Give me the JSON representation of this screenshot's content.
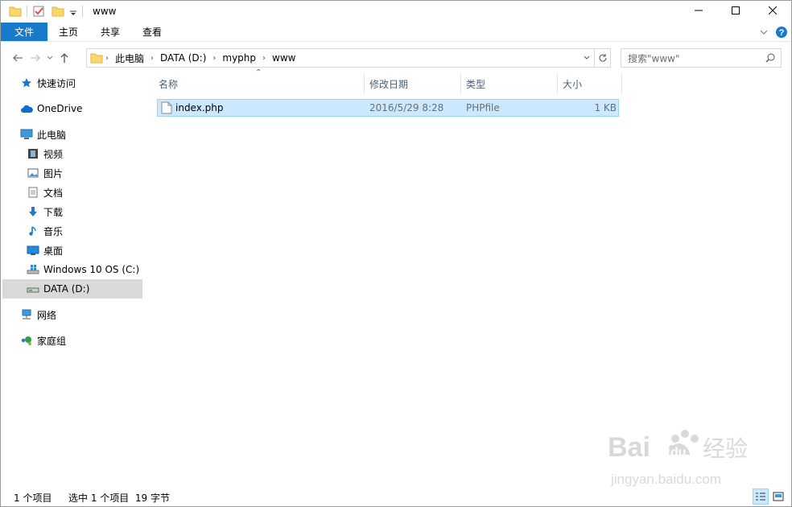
{
  "window": {
    "title": "www"
  },
  "ribbon": {
    "tabs": [
      "文件",
      "主页",
      "共享",
      "查看"
    ]
  },
  "address": {
    "crumbs": [
      "此电脑",
      "DATA (D:)",
      "myphp",
      "www"
    ]
  },
  "search": {
    "placeholder": "搜索\"www\""
  },
  "sidebar": {
    "items": [
      {
        "label": "快速访问",
        "icon": "star-icon"
      },
      {
        "label": "OneDrive",
        "icon": "onedrive-cloud-icon"
      },
      {
        "label": "此电脑",
        "icon": "computer-icon"
      },
      {
        "label": "视频",
        "icon": "video-icon"
      },
      {
        "label": "图片",
        "icon": "picture-icon"
      },
      {
        "label": "文档",
        "icon": "document-icon"
      },
      {
        "label": "下载",
        "icon": "download-icon"
      },
      {
        "label": "音乐",
        "icon": "music-icon"
      },
      {
        "label": "桌面",
        "icon": "desktop-icon"
      },
      {
        "label": "Windows 10 OS (C:)",
        "icon": "windows-drive-icon"
      },
      {
        "label": "DATA (D:)",
        "icon": "drive-icon"
      },
      {
        "label": "网络",
        "icon": "network-icon"
      },
      {
        "label": "家庭组",
        "icon": "homegroup-icon"
      }
    ],
    "selected": "DATA (D:)"
  },
  "columns": [
    "名称",
    "修改日期",
    "类型",
    "大小"
  ],
  "files": [
    {
      "name": "index.php",
      "modified": "2016/5/29 8:28",
      "type": "PHPfile",
      "size": "1 KB",
      "selected": true
    }
  ],
  "status": {
    "count": "1 个项目",
    "selection": "选中 1 个项目  19 字节"
  },
  "watermark": {
    "brand": "Baidu",
    "brand_cn": "经验",
    "url": "jingyan.baidu.com"
  },
  "colors": {
    "accent": "#1979ca",
    "selection": "#cce8ff",
    "selection_border": "#99d1ff",
    "folder": "#ffd766"
  }
}
